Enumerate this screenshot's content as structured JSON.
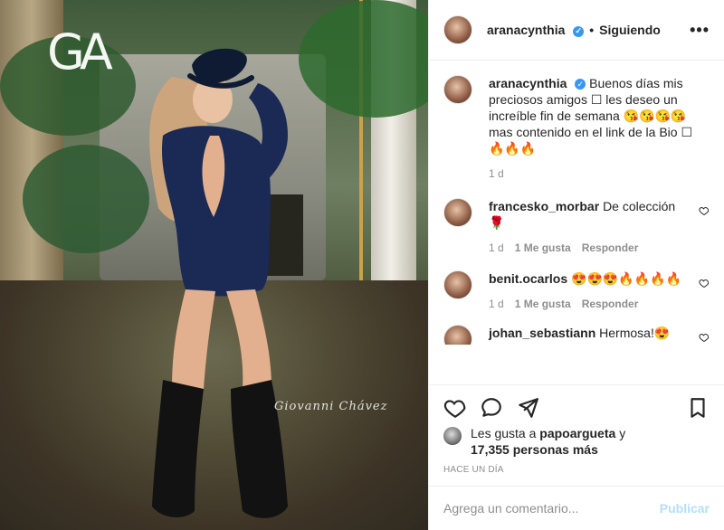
{
  "photo": {
    "logo_text": "GA",
    "signature_text": "Giovanni Chávez"
  },
  "header": {
    "username": "aranacynthia",
    "dot": "•",
    "follow_status": "Siguiendo",
    "more": "•••"
  },
  "caption": {
    "username": "aranacynthia",
    "text": "Buenos días mis preciosos amigos ☐ les deseo un increíble fin de semana 😘😘😘😘 mas contenido en el link de la Bio ☐ 🔥🔥🔥",
    "time": "1 d"
  },
  "comments": [
    {
      "username": "francesko_morbar",
      "text": "De colección 🌹",
      "time": "1 d",
      "likes": "1 Me gusta",
      "reply": "Responder"
    },
    {
      "username": "benit.ocarlos",
      "text": "😍😍😍🔥🔥🔥🔥",
      "time": "1 d",
      "likes": "1 Me gusta",
      "reply": "Responder"
    },
    {
      "username": "johan_sebastiann",
      "text": "Hermosa!😍"
    }
  ],
  "likes": {
    "prefix": "Les gusta a",
    "user": "papoargueta",
    "mid": "y",
    "count_text": "17,355 personas más"
  },
  "timestamp": "HACE UN DÍA",
  "composer": {
    "placeholder": "Agrega un comentario...",
    "post_label": "Publicar"
  },
  "colors": {
    "verified": "#3897f0",
    "publish_disabled": "#b2dffc",
    "muted": "#8e8e8e",
    "text": "#262626"
  }
}
